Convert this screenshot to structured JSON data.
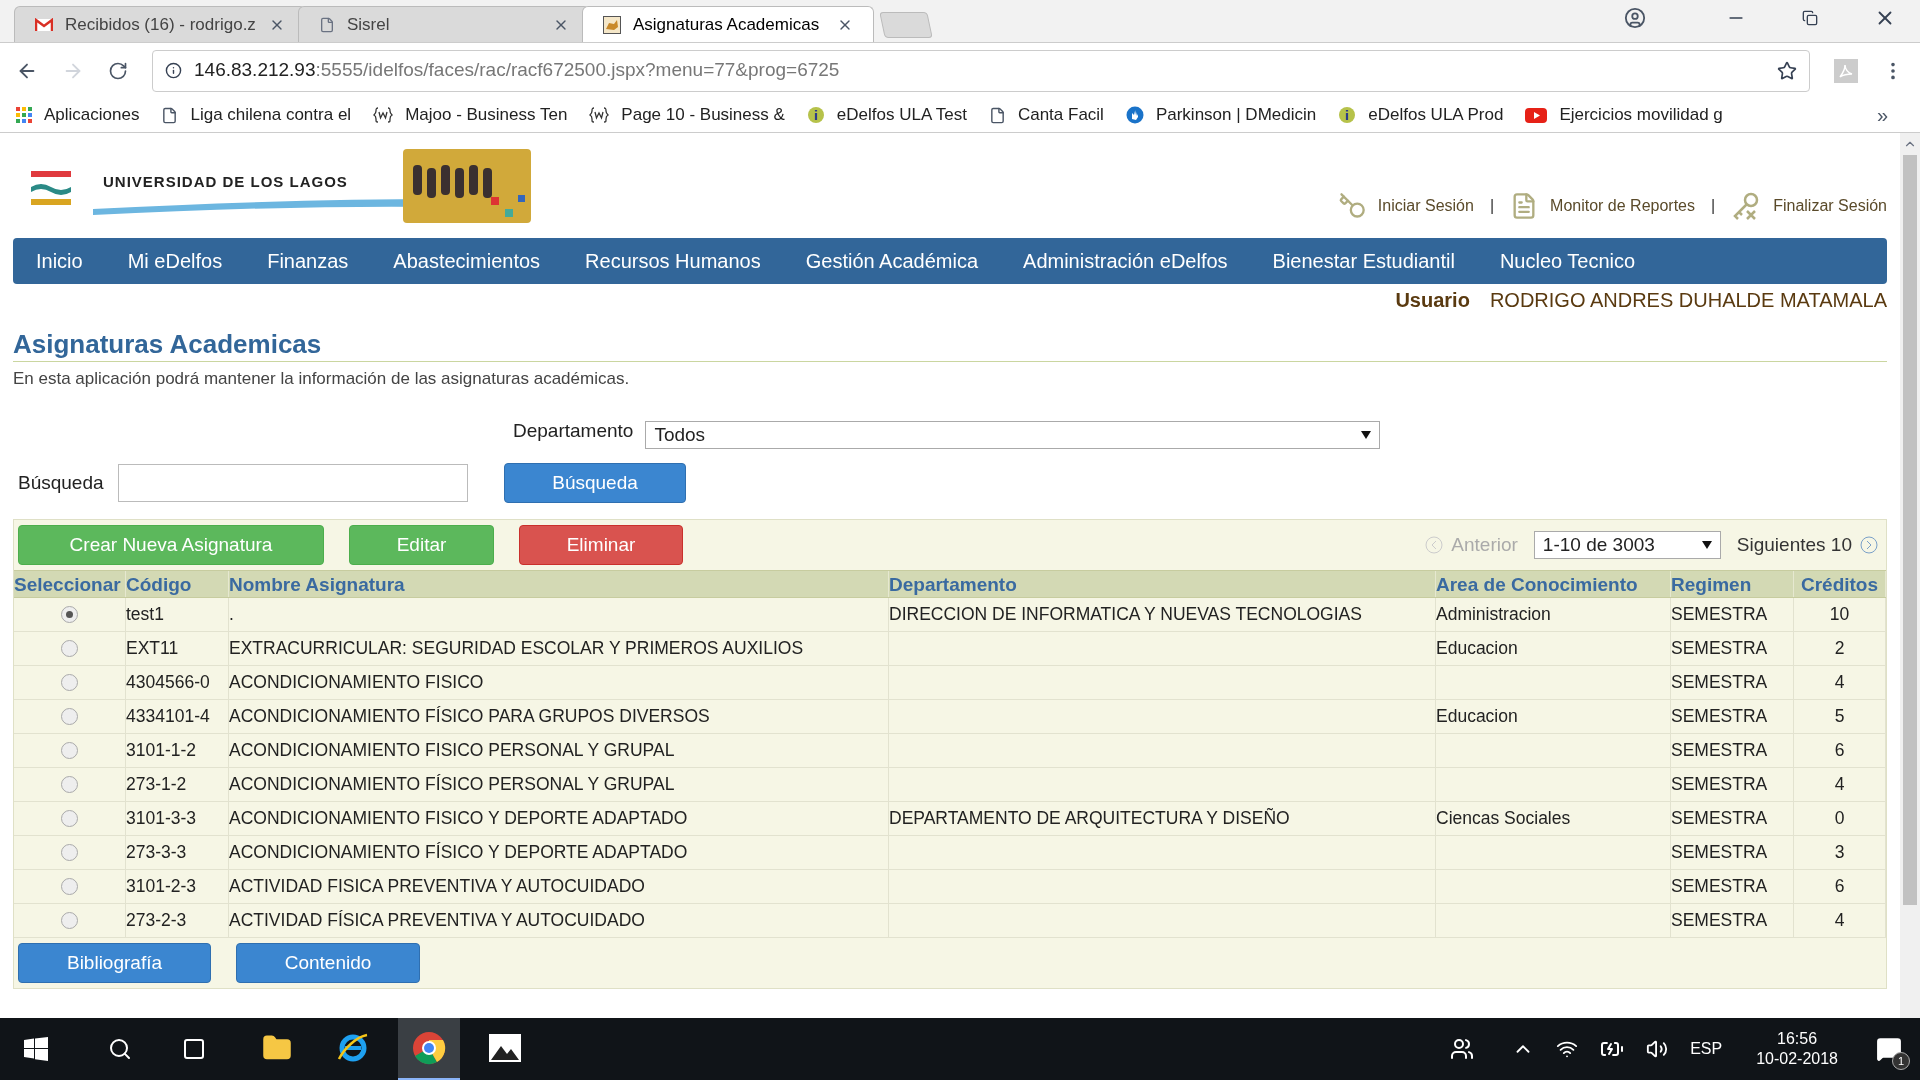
{
  "browser": {
    "tabs": [
      {
        "title": "Recibidos (16) - rodrigo.z",
        "kind": "mail",
        "selected": false
      },
      {
        "title": "Sisrel",
        "kind": "page",
        "selected": false
      },
      {
        "title": "Asignaturas Academicas",
        "kind": "app",
        "selected": true
      }
    ],
    "address": {
      "host": "146.83.212.93",
      "path": ":5555/idelfos/faces/rac/racf672500.jspx?menu=77&prog=6725"
    },
    "bookmarks": [
      {
        "label": "Aplicaciones",
        "kind": "apps"
      },
      {
        "label": "Liga chilena contra el",
        "kind": "page"
      },
      {
        "label": "Majoo - Business Ten",
        "kind": "w"
      },
      {
        "label": "Page 10 - Business &",
        "kind": "w"
      },
      {
        "label": "eDelfos  ULA Test",
        "kind": "info"
      },
      {
        "label": "Canta Facil",
        "kind": "page"
      },
      {
        "label": "Parkinson | DMedicin",
        "kind": "hand"
      },
      {
        "label": "eDelfos ULA Prod",
        "kind": "info"
      },
      {
        "label": "Ejercicios movilidad g",
        "kind": "video"
      }
    ],
    "more": "»"
  },
  "header": {
    "logo_text": "UNIVERSIDAD DE LOS LAGOS",
    "links": [
      {
        "label": "Iniciar Sesión",
        "kind": "key"
      },
      {
        "label": "Monitor de Reportes",
        "kind": "report"
      },
      {
        "label": "Finalizar Sesión",
        "kind": "keyx"
      }
    ],
    "separator": "|"
  },
  "nav": [
    "Inicio",
    "Mi eDelfos",
    "Finanzas",
    "Abastecimientos",
    "Recursos Humanos",
    "Gestión Académica",
    "Administración eDelfos",
    "Bienestar Estudiantil",
    "Nucleo Tecnico"
  ],
  "user": {
    "label": "Usuario",
    "name": "RODRIGO ANDRES DUHALDE MATAMALA"
  },
  "page": {
    "title": "Asignaturas Academicas",
    "description": "En esta aplicación podrá mantener la información de las asignaturas académicas."
  },
  "filters": {
    "department_label": "Departamento",
    "department_value": "Todos",
    "search_label": "Búsqueda",
    "search_button": "Búsqueda"
  },
  "toolbar": {
    "buttons": [
      {
        "label": "Crear Nueva Asignatura",
        "kind": "green"
      },
      {
        "label": "Editar",
        "kind": "green"
      },
      {
        "label": "Eliminar",
        "kind": "red"
      }
    ],
    "previous": {
      "label": "Anterior",
      "disabled": true
    },
    "range": "1-10 de 3003",
    "next": {
      "label": "Siguientes 10",
      "disabled": false
    }
  },
  "table": {
    "columns": [
      "Seleccionar",
      "Código",
      "Nombre Asignatura",
      "Departamento",
      "Area de Conocimiento",
      "Regimen",
      "Créditos"
    ],
    "rows": [
      {
        "selected": true,
        "code": "test1",
        "name": ".",
        "department": "DIRECCION DE INFORMATICA Y NUEVAS TECNOLOGIAS",
        "area": "Administracion",
        "regimen": "SEMESTRA",
        "credits": "10"
      },
      {
        "selected": false,
        "code": "EXT11",
        "name": "EXTRACURRICULAR: SEGURIDAD ESCOLAR Y PRIMEROS AUXILIOS",
        "area": "Educacion",
        "regimen": "SEMESTRA",
        "credits": "2"
      },
      {
        "selected": false,
        "code": "4304566-0",
        "name": "ACONDICIONAMIENTO FISICO",
        "regimen": "SEMESTRA",
        "credits": "4"
      },
      {
        "selected": false,
        "code": "4334101-4",
        "name": "ACONDICIONAMIENTO FÍSICO PARA GRUPOS DIVERSOS",
        "area": "Educacion",
        "regimen": "SEMESTRA",
        "credits": "5"
      },
      {
        "selected": false,
        "code": "3101-1-2",
        "name": "ACONDICIONAMIENTO FISICO PERSONAL Y GRUPAL",
        "regimen": "SEMESTRA",
        "credits": "6"
      },
      {
        "selected": false,
        "code": "273-1-2",
        "name": "ACONDICIONAMIENTO FÍSICO PERSONAL Y GRUPAL",
        "regimen": "SEMESTRA",
        "credits": "4"
      },
      {
        "selected": false,
        "code": "3101-3-3",
        "name": "ACONDICIONAMIENTO FISICO Y DEPORTE ADAPTADO",
        "department": "DEPARTAMENTO DE ARQUITECTURA Y DISEÑO",
        "area": "Ciencas Sociales",
        "regimen": "SEMESTRA",
        "credits": "0"
      },
      {
        "selected": false,
        "code": "273-3-3",
        "name": "ACONDICIONAMIENTO FÍSICO Y DEPORTE ADAPTADO",
        "regimen": "SEMESTRA",
        "credits": "3"
      },
      {
        "selected": false,
        "code": "3101-2-3",
        "name": "ACTIVIDAD FISICA PREVENTIVA Y AUTOCUIDADO",
        "regimen": "SEMESTRA",
        "credits": "6"
      },
      {
        "selected": false,
        "code": "273-2-3",
        "name": "ACTIVIDAD FÍSICA PREVENTIVA Y AUTOCUIDADO",
        "regimen": "SEMESTRA",
        "credits": "4"
      }
    ]
  },
  "bottom_buttons": [
    "Bibliografía",
    "Contenido"
  ],
  "taskbar": {
    "apps": [
      {
        "kind": "folder",
        "selected": false
      },
      {
        "kind": "ie",
        "selected": false
      },
      {
        "kind": "chrome",
        "selected": true
      },
      {
        "kind": "photos",
        "selected": false
      }
    ],
    "language": "ESP",
    "time": "16:56",
    "date": "10-02-2018",
    "notifications": "1"
  }
}
